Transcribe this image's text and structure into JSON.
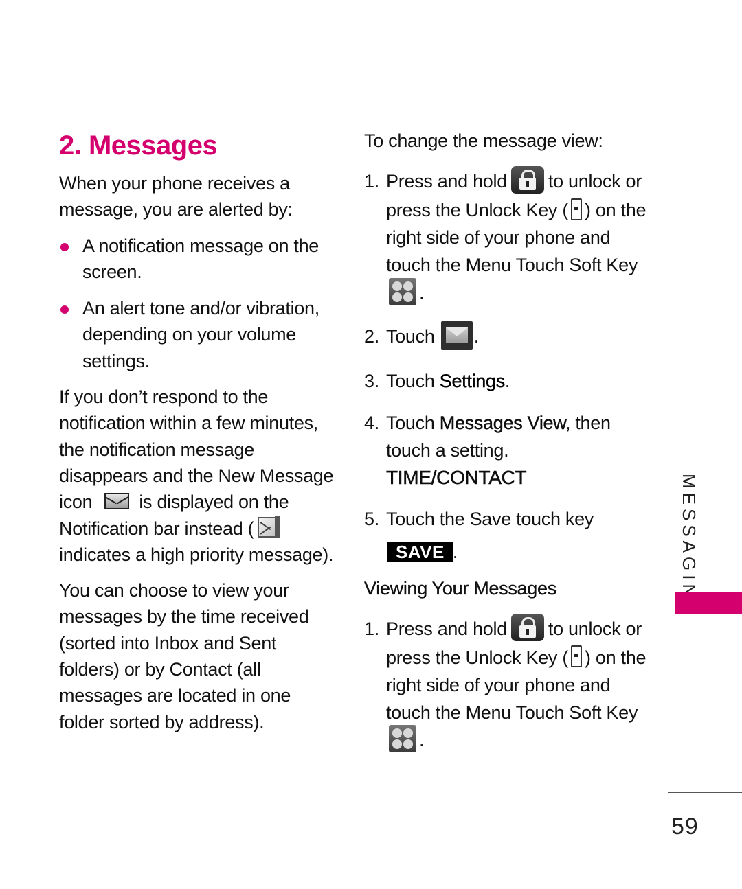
{
  "section": {
    "title": "2. Messages",
    "intro": "When your phone receives a message, you are alerted by:",
    "bullets": [
      "A notification message on the screen.",
      "An alert tone and/or vibration, depending on your volume settings."
    ],
    "para2": {
      "part1": "If you don’t respond to the notification within a few minutes, the notification message disappears and the New Message icon",
      "part2": "is displayed on the Notification bar instead (",
      "part3": "indicates a high priority message)."
    },
    "para3": "You can choose to view your messages by the time received (sorted into Inbox and Sent folders) or by Contact (all messages are located in one folder sorted by address)."
  },
  "change_view": {
    "heading": "To change the message view:",
    "steps": [
      {
        "num": "1.",
        "part1": "Press and hold",
        "part2": "to unlock or press the Unlock Key (",
        "part3": ") on the right side of your phone and touch the Menu Touch Soft Key",
        "part4": "."
      },
      {
        "num": "2.",
        "part1": "Touch",
        "part2": "."
      },
      {
        "num": "3.",
        "part1": "Touch ",
        "bold": "Settings",
        "part2": "."
      },
      {
        "num": "4.",
        "part1": "Touch ",
        "bold": "Messages View",
        "part2": ", then touch a setting.",
        "option": "TIME/CONTACT"
      },
      {
        "num": "5.",
        "part1": "Touch the Save touch key",
        "key_label": "SAVE",
        "part2": "."
      }
    ]
  },
  "viewing": {
    "heading": "Viewing Your Messages",
    "steps": [
      {
        "num": "1.",
        "part1": "Press and hold",
        "part2": "to unlock or press the Unlock Key (",
        "part3": ") on the right side of your phone and touch the Menu Touch Soft Key",
        "part4": "."
      }
    ]
  },
  "sidebar": {
    "label": "MESSAGING"
  },
  "page_number": "59",
  "icons": {
    "lock": "lock-icon",
    "unlock_key": "unlock-key-icon",
    "menu": "menu-grid-icon",
    "messaging": "envelope-icon",
    "new_message": "new-message-icon",
    "priority_message": "priority-message-icon"
  },
  "colors": {
    "accent": "#d4006e",
    "text": "#111111"
  }
}
